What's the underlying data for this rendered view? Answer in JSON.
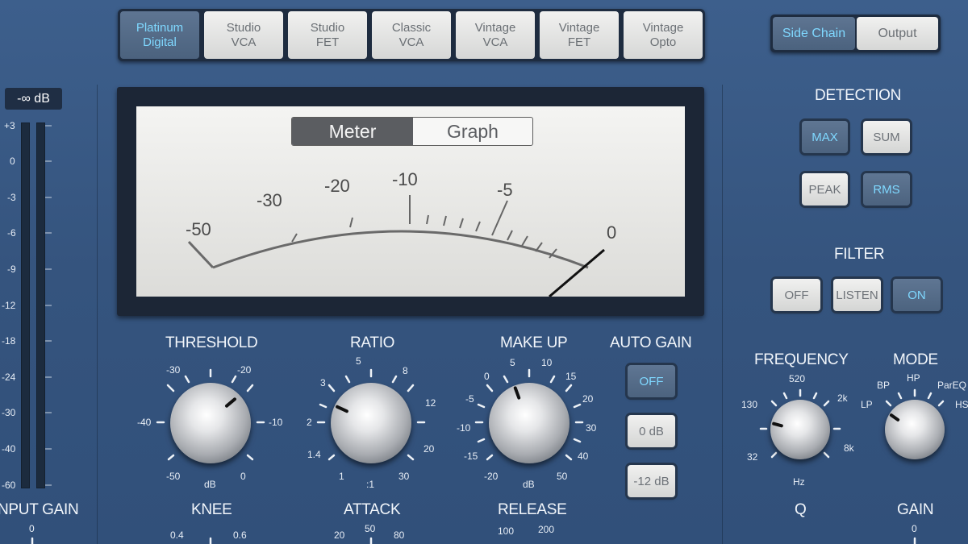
{
  "comp_types": [
    {
      "label": "Platinum\nDigital",
      "active": true
    },
    {
      "label": "Studio\nVCA",
      "active": false
    },
    {
      "label": "Studio\nFET",
      "active": false
    },
    {
      "label": "Classic\nVCA",
      "active": false
    },
    {
      "label": "Vintage\nVCA",
      "active": false
    },
    {
      "label": "Vintage\nFET",
      "active": false
    },
    {
      "label": "Vintage\nOpto",
      "active": false
    }
  ],
  "view_tabs": {
    "side_chain": "Side Chain",
    "output": "Output"
  },
  "input": {
    "readout": "-∞ dB",
    "scale": [
      "+3",
      "0",
      "-3",
      "-6",
      "-9",
      "-12",
      "-18",
      "-24",
      "-30",
      "-40",
      "-60"
    ],
    "label": "INPUT GAIN",
    "value_label": "0"
  },
  "meter": {
    "tab_meter": "Meter",
    "tab_graph": "Graph",
    "scale": [
      "-50",
      "-30",
      "-20",
      "-10",
      "-5",
      "0"
    ]
  },
  "threshold": {
    "label": "THRESHOLD",
    "ticks": [
      "-30",
      "-20",
      "-40",
      "-10",
      "-50",
      "0"
    ],
    "unit": "dB"
  },
  "ratio": {
    "label": "RATIO",
    "ticks": [
      "5",
      "8",
      "3",
      "12",
      "2",
      "20",
      "1.4",
      "30",
      "1"
    ],
    "unit": ":1"
  },
  "makeup": {
    "label": "MAKE UP",
    "ticks": [
      "5",
      "10",
      "0",
      "15",
      "-5",
      "20",
      "-10",
      "30",
      "-15",
      "40",
      "-20",
      "50"
    ],
    "unit": "dB"
  },
  "auto_gain": {
    "label": "AUTO GAIN",
    "off": "OFF",
    "zero": "0 dB",
    "minus12": "-12 dB"
  },
  "knee": {
    "label": "KNEE",
    "ticks": [
      "0.4",
      "0.6"
    ]
  },
  "attack": {
    "label": "ATTACK",
    "ticks": [
      "50",
      "20",
      "80"
    ]
  },
  "release": {
    "label": "RELEASE",
    "ticks": [
      "100",
      "200"
    ]
  },
  "detection": {
    "label": "DETECTION",
    "max": "MAX",
    "sum": "SUM",
    "peak": "PEAK",
    "rms": "RMS"
  },
  "filter": {
    "label": "FILTER",
    "off": "OFF",
    "listen": "LISTEN",
    "on": "ON"
  },
  "frequency": {
    "label": "FREQUENCY",
    "ticks": [
      "520",
      "130",
      "2k",
      "32",
      "8k"
    ],
    "unit": "Hz"
  },
  "mode": {
    "label": "MODE",
    "ticks": [
      "HP",
      "BP",
      "ParEQ",
      "LP",
      "HS"
    ]
  },
  "q": {
    "label": "Q"
  },
  "gain": {
    "label": "GAIN",
    "value_label": "0"
  },
  "colors": {
    "active_text": "#7fd8ff",
    "panel": "#3a5a86",
    "meter_face": "#e9e9e6"
  }
}
